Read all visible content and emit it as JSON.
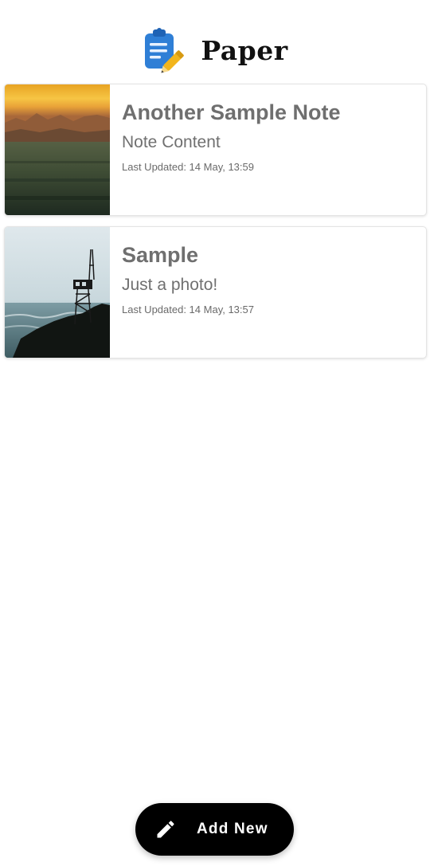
{
  "app": {
    "title": "Paper"
  },
  "notes": [
    {
      "title": "Another Sample Note",
      "content": "Note Content",
      "updated": "Last Updated: 14 May, 13:59"
    },
    {
      "title": "Sample",
      "content": "Just a photo!",
      "updated": "Last Updated: 14 May, 13:57"
    }
  ],
  "fab": {
    "label": "Add New",
    "icon": "pencil-icon"
  },
  "colors": {
    "logo_blue": "#2f7fd6",
    "logo_pencil": "#f2b51c",
    "fab_background": "#000000"
  }
}
